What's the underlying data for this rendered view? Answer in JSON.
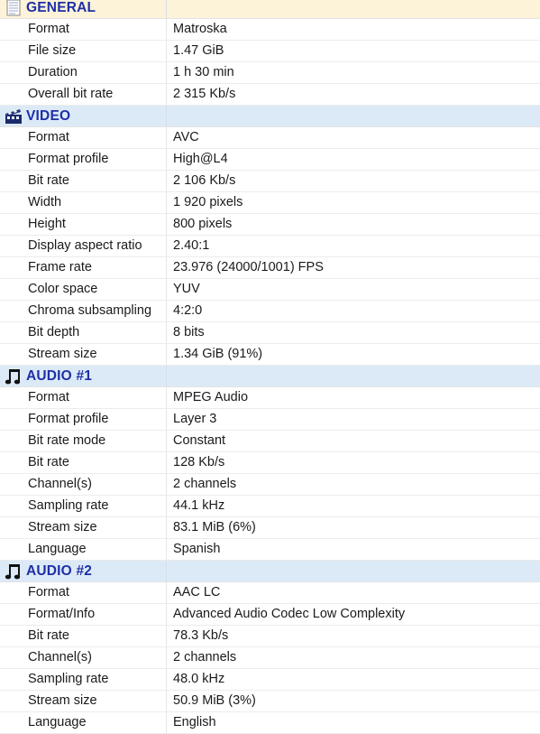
{
  "sections": [
    {
      "title": "GENERAL",
      "icon": "document-icon",
      "rows": [
        {
          "label": "Format",
          "value": "Matroska"
        },
        {
          "label": "File size",
          "value": "1.47 GiB"
        },
        {
          "label": "Duration",
          "value": "1 h 30 min"
        },
        {
          "label": "Overall bit rate",
          "value": "2 315 Kb/s"
        }
      ]
    },
    {
      "title": "VIDEO",
      "icon": "film-clapper-icon",
      "rows": [
        {
          "label": "Format",
          "value": "AVC"
        },
        {
          "label": "Format profile",
          "value": "High@L4"
        },
        {
          "label": "Bit rate",
          "value": "2 106 Kb/s"
        },
        {
          "label": "Width",
          "value": "1 920 pixels"
        },
        {
          "label": "Height",
          "value": "800 pixels"
        },
        {
          "label": "Display aspect ratio",
          "value": "2.40:1"
        },
        {
          "label": "Frame rate",
          "value": "23.976 (24000/1001) FPS"
        },
        {
          "label": "Color space",
          "value": "YUV"
        },
        {
          "label": "Chroma subsampling",
          "value": "4:2:0"
        },
        {
          "label": "Bit depth",
          "value": "8 bits"
        },
        {
          "label": "Stream size",
          "value": "1.34 GiB (91%)"
        }
      ]
    },
    {
      "title": "AUDIO #1",
      "icon": "music-note-icon",
      "rows": [
        {
          "label": "Format",
          "value": "MPEG Audio"
        },
        {
          "label": "Format profile",
          "value": "Layer 3"
        },
        {
          "label": "Bit rate mode",
          "value": "Constant"
        },
        {
          "label": "Bit rate",
          "value": "128 Kb/s"
        },
        {
          "label": "Channel(s)",
          "value": "2 channels"
        },
        {
          "label": "Sampling rate",
          "value": "44.1 kHz"
        },
        {
          "label": "Stream size",
          "value": "83.1 MiB (6%)"
        },
        {
          "label": "Language",
          "value": "Spanish"
        }
      ]
    },
    {
      "title": "AUDIO #2",
      "icon": "music-note-icon",
      "rows": [
        {
          "label": "Format",
          "value": "AAC LC"
        },
        {
          "label": "Format/Info",
          "value": "Advanced Audio Codec Low Complexity"
        },
        {
          "label": "Bit rate",
          "value": "78.3 Kb/s"
        },
        {
          "label": "Channel(s)",
          "value": "2 channels"
        },
        {
          "label": "Sampling rate",
          "value": "48.0 kHz"
        },
        {
          "label": "Stream size",
          "value": "50.9 MiB (3%)"
        },
        {
          "label": "Language",
          "value": "English"
        }
      ]
    }
  ]
}
